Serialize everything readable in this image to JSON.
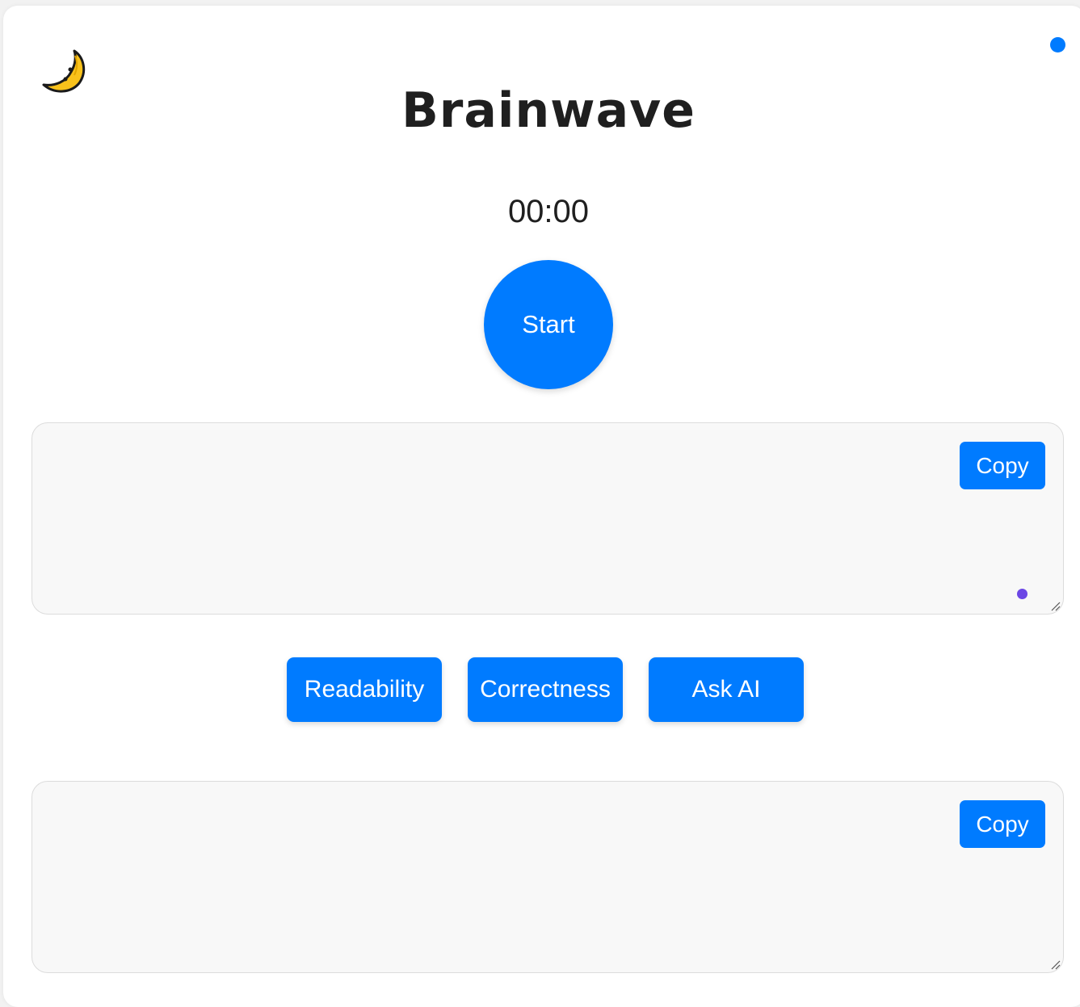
{
  "header": {
    "theme_toggle_icon": "crescent-moon-icon",
    "status_dot_color": "#007bff",
    "title": "Brainwave"
  },
  "recorder": {
    "timer": "00:00",
    "start_label": "Start"
  },
  "transcript": {
    "value": "",
    "copy_label": "Copy"
  },
  "actions": [
    {
      "label": "Readability"
    },
    {
      "label": "Correctness"
    },
    {
      "label": "Ask AI"
    }
  ],
  "result": {
    "value": "",
    "copy_label": "Copy"
  },
  "colors": {
    "accent": "#007bff",
    "text": "#1f1f1f",
    "panel": "#f8f8f8",
    "grammar_dot": "#6c47e5"
  }
}
